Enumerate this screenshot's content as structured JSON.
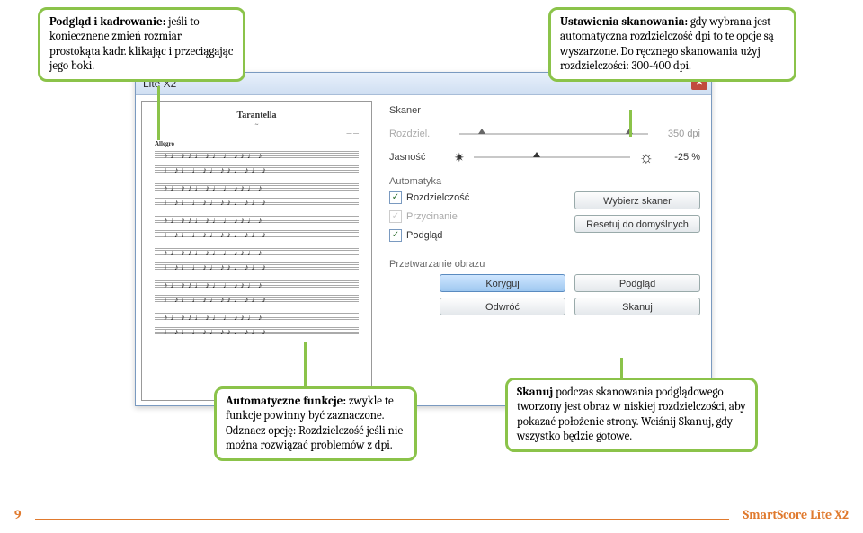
{
  "callouts": {
    "topleft": {
      "title": "Podgląd i kadrowanie:",
      "body": "jeśli to koniecznene zmień rozmiar prostokąta kadr. klikając i przeciągając jego boki."
    },
    "topright": {
      "title": "Ustawienia skanowania:",
      "body": "gdy wybrana jest automatyczna rozdzielczość dpi to te opcje są wyszarzone. Do ręcznego skanowania użyj rozdzielczości: 300-400 dpi."
    },
    "bottomleft": {
      "title": "Automatyczne funkcje:",
      "body": "zwykle te funkcje powinny być zaznaczone. Odznacz opcję: Rozdzielczość jeśli nie można rozwiązać problemów z dpi."
    },
    "bottomright": {
      "title": "Skanuj",
      "body": "podczas skanowania podglądowego tworzony jest obraz w niskiej rozdzielczości, aby pokazać położenie strony. Wciśnij Skanuj, gdy wszystko będzie gotowe."
    }
  },
  "dialog": {
    "title": "Lite X2",
    "labels": {
      "skaner": "Skaner",
      "rozdziel": "Rozdziel.",
      "jasnosc": "Jasność",
      "automatyka": "Automatyka",
      "przetwarzanie": "Przetwarzanie obrazu"
    },
    "values": {
      "dpi": "350 dpi",
      "brightness": "-25 %"
    },
    "checks": {
      "rozdzielczosc": "Rozdzielczość",
      "przycinanie": "Przycinanie",
      "podglad": "Podgląd"
    },
    "buttons": {
      "wybierz": "Wybierz skaner",
      "resetuj": "Resetuj do domyślnych",
      "koryguj": "Koryguj",
      "odwroc": "Odwróć",
      "podglad": "Podgląd",
      "skanuj": "Skanuj"
    },
    "sheet": {
      "title": "Tarantella",
      "subtitle": "",
      "composer": "",
      "tempo": "Allegro"
    }
  },
  "footer": {
    "page": "9",
    "product": "SmartScore Lite X2"
  }
}
